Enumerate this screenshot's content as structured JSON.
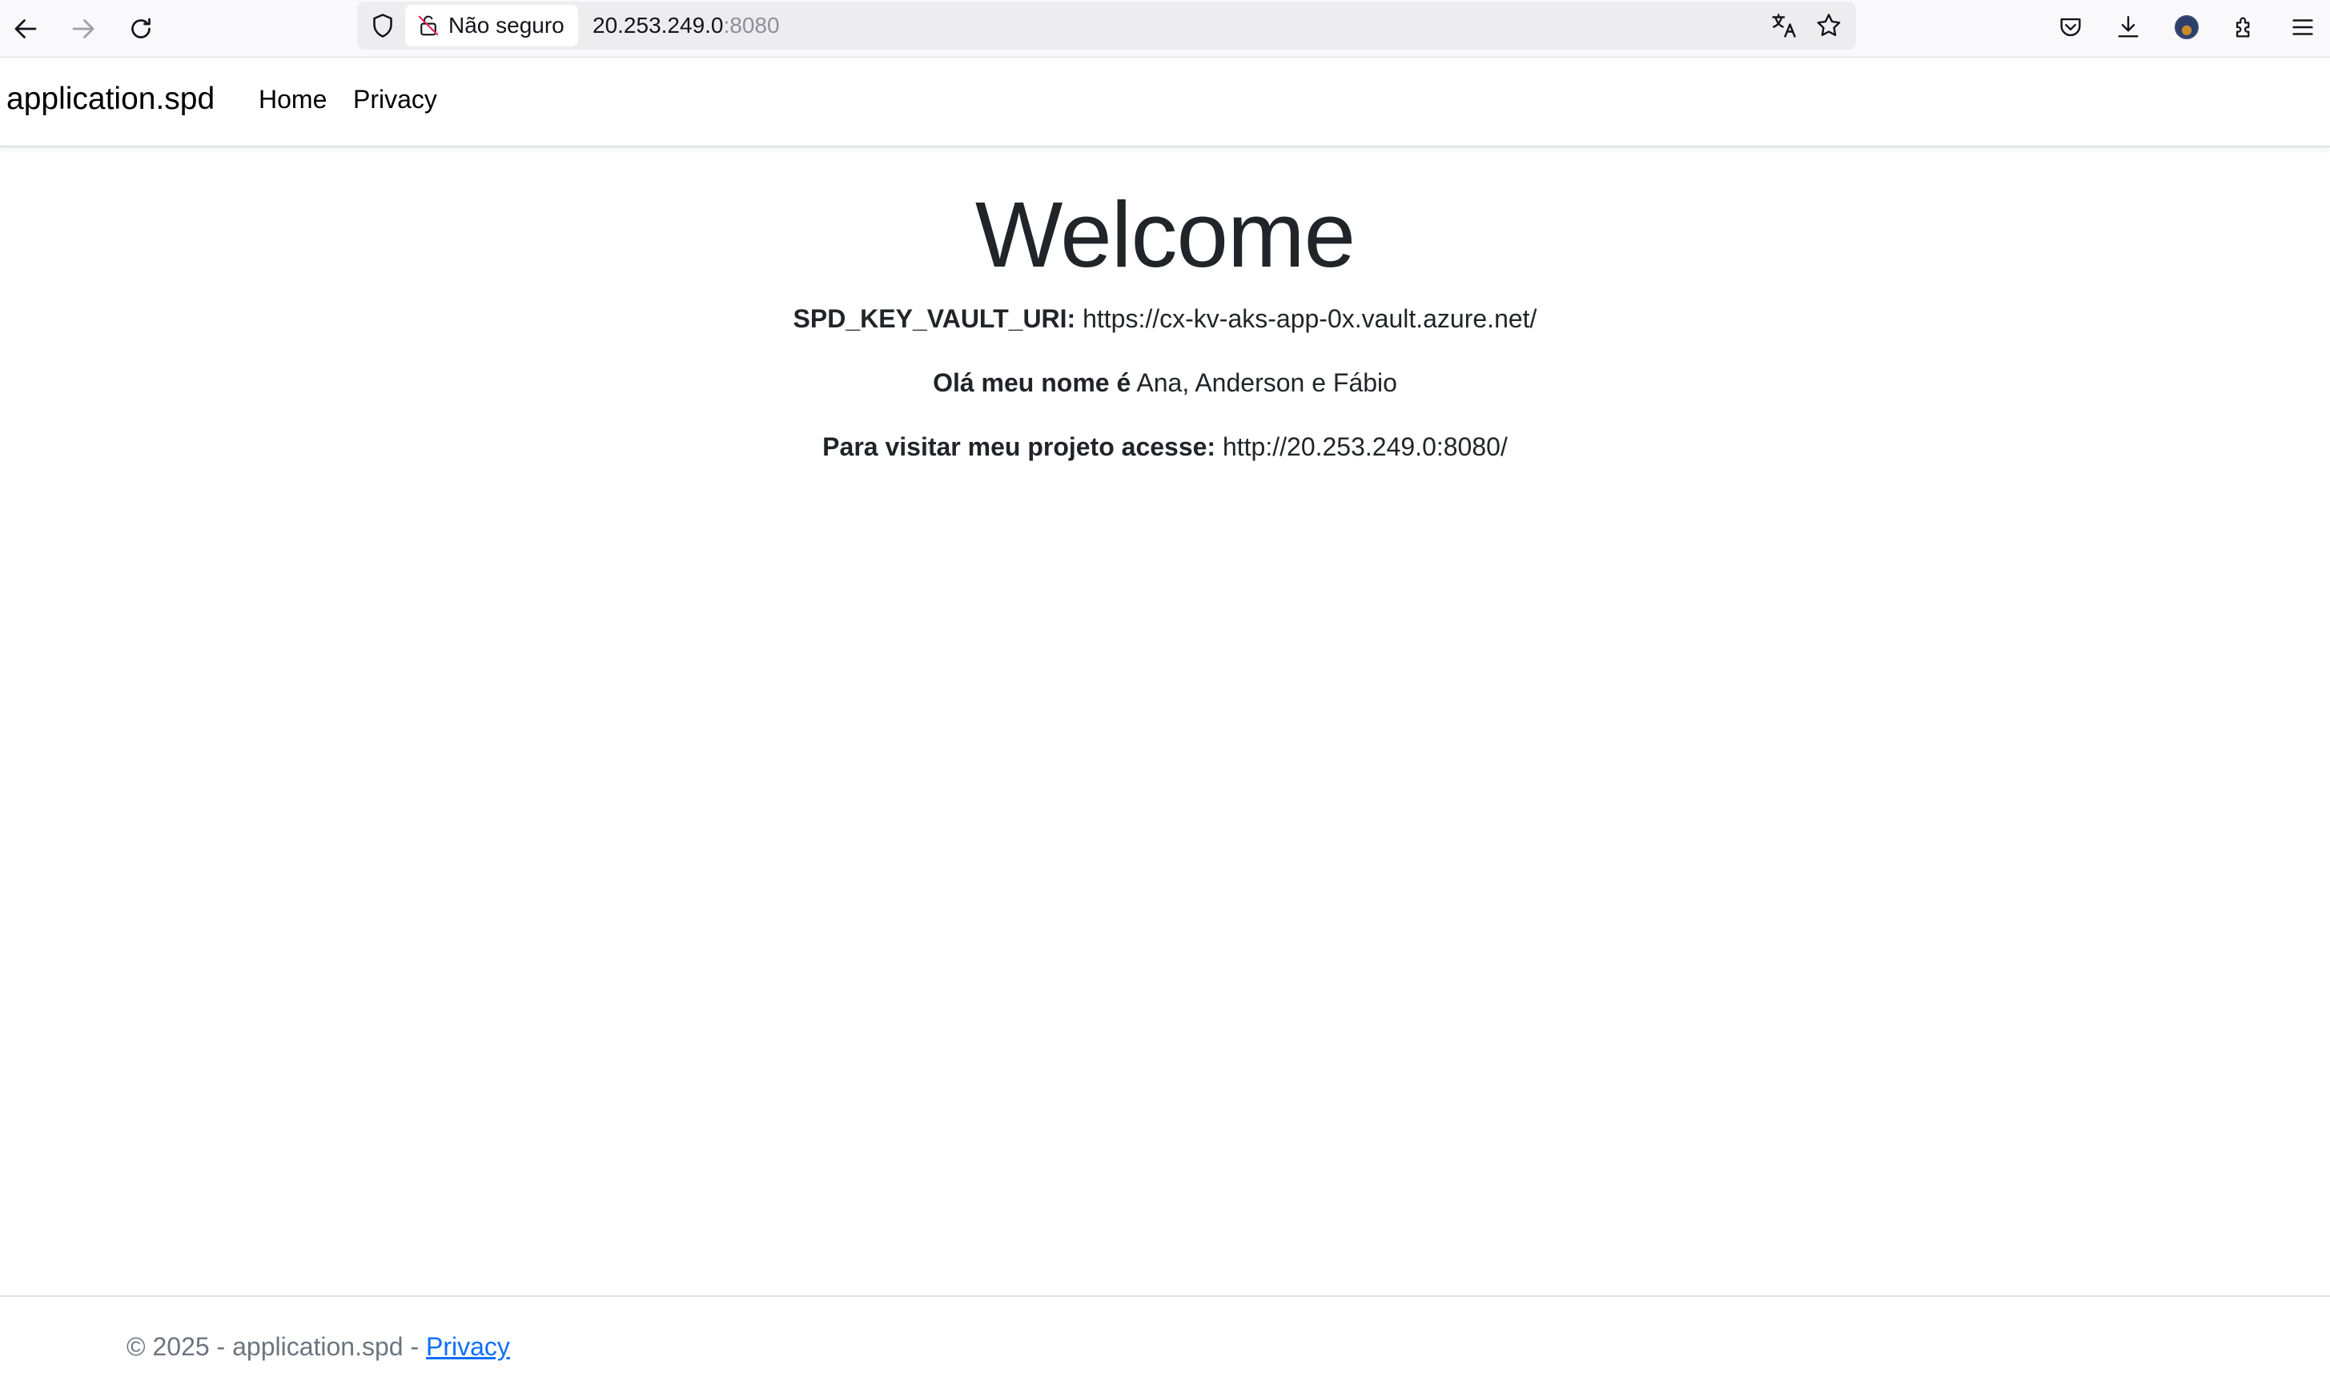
{
  "browser": {
    "security_label": "Não seguro",
    "url_host": "20.253.249.0",
    "url_port": ":8080",
    "icons": [
      "back-arrow-icon",
      "forward-arrow-icon",
      "reload-icon",
      "shield-icon",
      "insecure-lock-icon",
      "translate-icon",
      "bookmark-star-icon",
      "pocket-icon",
      "download-icon",
      "account-avatar-icon",
      "extensions-icon",
      "menu-icon"
    ]
  },
  "navbar": {
    "brand": "application.spd",
    "links": [
      {
        "label": "Home"
      },
      {
        "label": "Privacy"
      }
    ]
  },
  "main": {
    "heading": "Welcome",
    "lines": [
      {
        "label": "SPD_KEY_VAULT_URI:",
        "value": " https://cx-kv-aks-app-0x.vault.azure.net/"
      },
      {
        "label": "Olá meu nome é",
        "value": " Ana, Anderson e Fábio"
      },
      {
        "label": "Para visitar meu projeto acesse:",
        "value": " http://20.253.249.0:8080/"
      }
    ]
  },
  "footer": {
    "text": "© 2025 - application.spd - ",
    "link": "Privacy"
  },
  "colors": {
    "link": "#0d6efd",
    "text": "#212529",
    "muted": "#6c757d"
  }
}
